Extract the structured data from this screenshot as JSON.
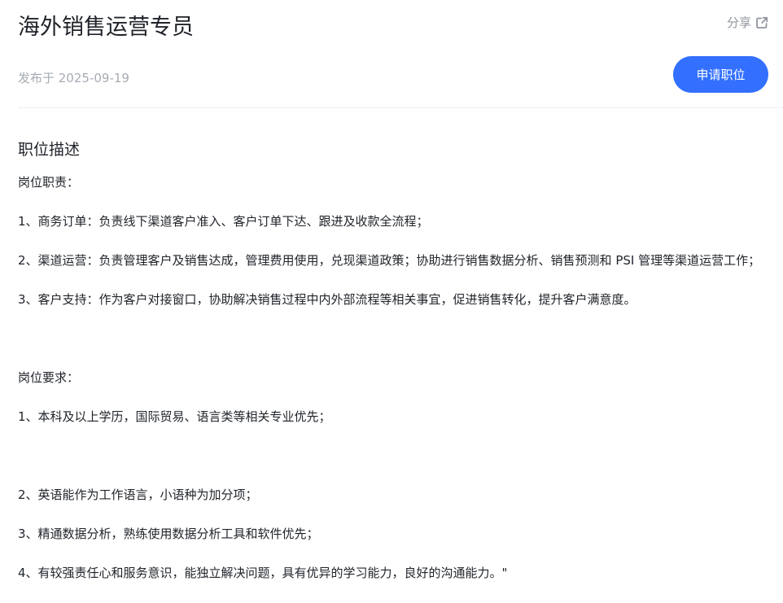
{
  "job": {
    "title": "海外销售运营专员",
    "share_label": "分享",
    "publish_date": "发布于 2025-09-19",
    "apply_label": "申请职位"
  },
  "description": {
    "heading": "职位描述",
    "responsibilities_title": "岗位职责：",
    "responsibilities": [
      "1、商务订单：负责线下渠道客户准入、客户订单下达、跟进及收款全流程；",
      "2、渠道运营：负责管理客户及销售达成，管理费用使用，兑现渠道政策；协助进行销售数据分析、销售预测和 PSI 管理等渠道运营工作；",
      "3、客户支持：作为客户对接窗口，协助解决销售过程中内外部流程等相关事宜，促进销售转化，提升客户满意度。"
    ],
    "requirements_title": "岗位要求：",
    "requirements": [
      "1、本科及以上学历，国际贸易、语言类等相关专业优先；",
      "2、英语能作为工作语言，小语种为加分项；",
      "3、精通数据分析，熟练使用数据分析工具和软件优先；",
      "4、有较强责任心和服务意识，能独立解决问题，具有优异的学习能力，良好的沟通能力。\""
    ]
  }
}
